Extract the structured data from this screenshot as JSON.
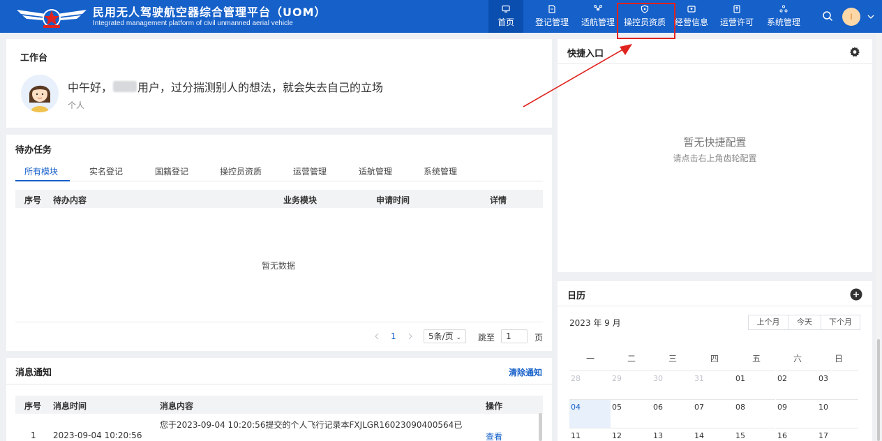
{
  "header": {
    "title": "民用无人驾驶航空器综合管理平台（UOM）",
    "subtitle": "Integrated management platform of civil unmanned aerial vehicle",
    "nav": [
      {
        "label": "首页",
        "icon": "monitor-icon"
      },
      {
        "label": "登记管理",
        "icon": "document-icon"
      },
      {
        "label": "适航管理",
        "icon": "drone-icon"
      },
      {
        "label": "操控员资质",
        "icon": "shield-icon"
      },
      {
        "label": "经营信息",
        "icon": "card-icon"
      },
      {
        "label": "运营许可",
        "icon": "upload-icon"
      },
      {
        "label": "系统管理",
        "icon": "cluster-icon"
      }
    ],
    "user_initial": "I"
  },
  "workbench": {
    "title": "工作台",
    "greeting_prefix": "中午好，",
    "greeting_suffix": "用户，过分揣测别人的想法，就会失去自己的立场",
    "role": "个人"
  },
  "todo": {
    "title": "待办任务",
    "tabs": [
      "所有模块",
      "实名登记",
      "国籍登记",
      "操控员资质",
      "运营管理",
      "适航管理",
      "系统管理"
    ],
    "columns": [
      "序号",
      "待办内容",
      "业务模块",
      "申请时间",
      "详情"
    ],
    "empty_text": "暂无数据",
    "pagination": {
      "page": "1",
      "page_size": "5条/页",
      "goto_label": "跳至",
      "goto_value": "1",
      "page_unit": "页"
    }
  },
  "notice": {
    "title": "消息通知",
    "clear_label": "清除通知",
    "columns": [
      "序号",
      "消息时间",
      "消息内容",
      "操作"
    ],
    "rows": [
      {
        "index": "1",
        "time": "2023-09-04 10:20:56",
        "content": "您于2023-09-04 10:20:56提交的个人飞行记录本FXJLGR16023090400564已",
        "action": "查看"
      }
    ]
  },
  "shortcut": {
    "title": "快捷入口",
    "empty_title": "暂无快捷配置",
    "empty_hint": "请点击右上角齿轮配置"
  },
  "calendar": {
    "title": "日历",
    "month_label": "2023 年 9 月",
    "buttons": [
      "上个月",
      "今天",
      "下个月"
    ],
    "weekdays": [
      "一",
      "二",
      "三",
      "四",
      "五",
      "六",
      "日"
    ],
    "weeks": [
      [
        "28",
        "29",
        "30",
        "31",
        "01",
        "02",
        "03"
      ],
      [
        "04",
        "05",
        "06",
        "07",
        "08",
        "09",
        "10"
      ],
      [
        "11",
        "12",
        "13",
        "14",
        "15",
        "16",
        "17"
      ]
    ]
  }
}
